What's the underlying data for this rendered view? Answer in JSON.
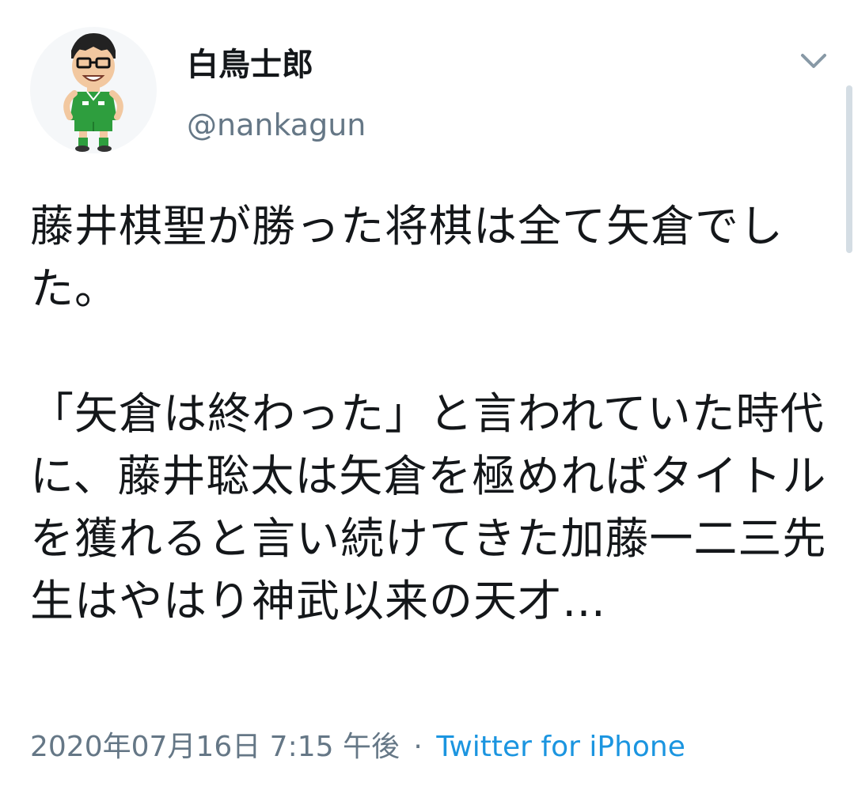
{
  "tweet": {
    "display_name": "白鳥士郎",
    "handle": "@nankagun",
    "text": "藤井棋聖が勝った将棋は全て矢倉でした。\n\n「矢倉は終わった」と言われていた時代に、藤井聡太は矢倉を極めればタイトルを獲れると言い続けてきた加藤一二三先生はやはり神武以来の天才…",
    "timestamp": "2020年07月16日 7:15 午後",
    "separator": "·",
    "source": "Twitter for iPhone"
  },
  "colors": {
    "text": "#14171a",
    "secondary": "#657786",
    "link": "#1b95e0",
    "jersey": "#2e9e3e"
  },
  "icons": {
    "menu": "chevron-down-icon",
    "avatar": "cartoon-soccer-player"
  }
}
